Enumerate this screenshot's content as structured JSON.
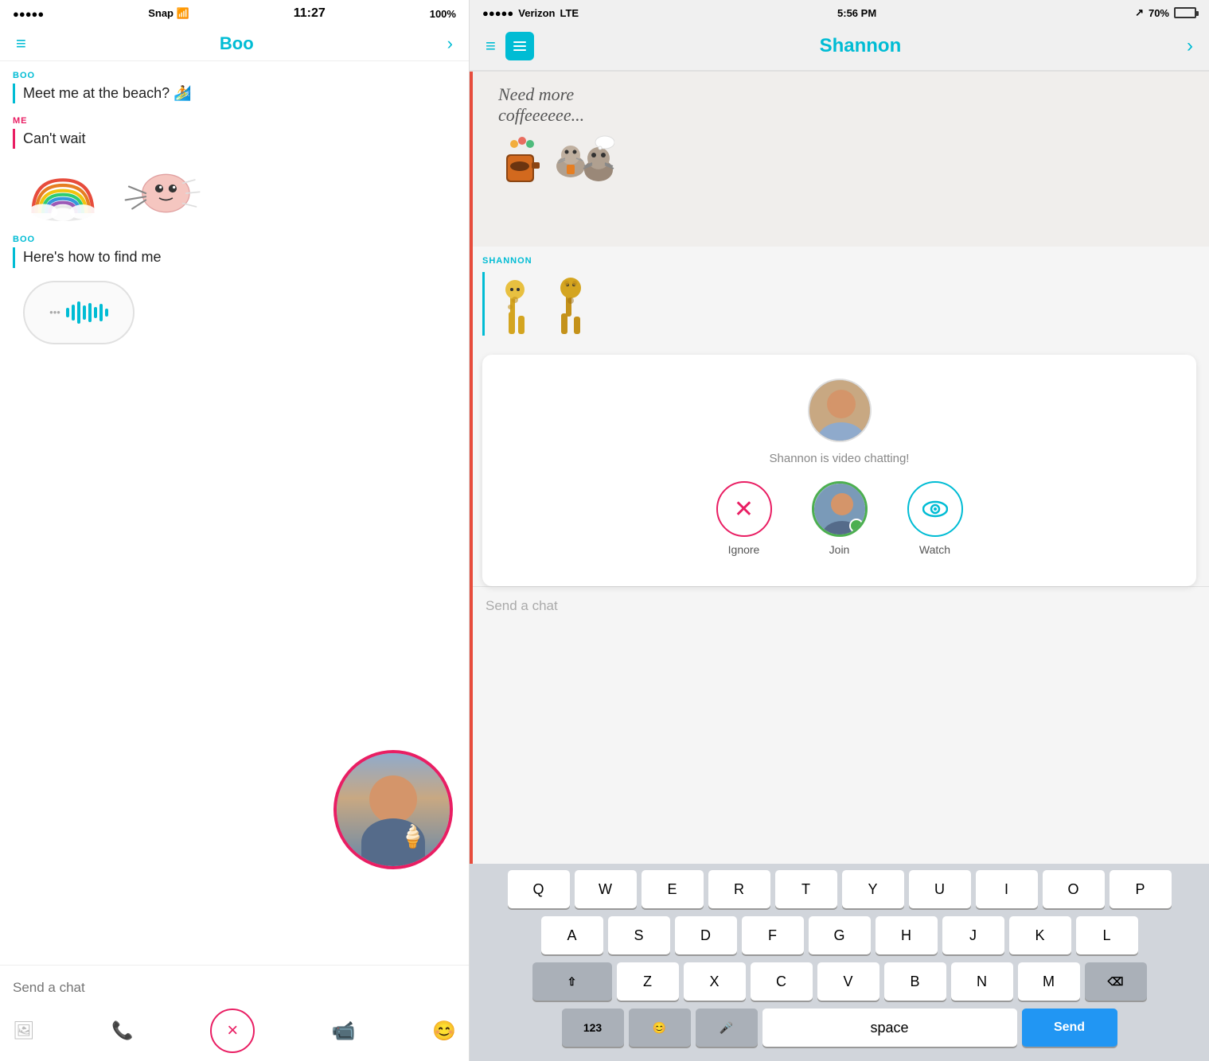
{
  "left": {
    "status_bar": {
      "dots": "●●●●●",
      "carrier": "Snap",
      "wifi": "WiFi",
      "time": "11:27",
      "battery": "100%"
    },
    "header": {
      "hamburger": "≡",
      "title": "Boo",
      "chevron": "›"
    },
    "messages": [
      {
        "sender": "BOO",
        "sender_type": "boo",
        "text": "Meet me at the beach? 🏄"
      },
      {
        "sender": "ME",
        "sender_type": "me",
        "text": "Can't wait"
      },
      {
        "sender": "BOO",
        "sender_type": "boo",
        "text": "Here's how to find me"
      }
    ],
    "bottom_bar": {
      "placeholder": "Send a chat"
    },
    "actions": {
      "cancel": "×",
      "image_icon": "🖼",
      "phone_icon": "📞",
      "video_icon": "📹",
      "emoji_icon": "😊"
    }
  },
  "right": {
    "status_bar": {
      "dots": "●●●●●",
      "carrier": "Verizon",
      "network": "LTE",
      "time": "5:56 PM",
      "location_icon": "↗",
      "battery": "70%"
    },
    "header": {
      "hamburger": "≡",
      "bars_label": "bars-chart",
      "title": "Shannon",
      "chevron": "›"
    },
    "sticker_section": {
      "coffee_text_line1": "Need more",
      "coffee_text_line2": "coffeeeeee..."
    },
    "shannon_label": "SHANNON",
    "video_chat": {
      "status_text": "Shannon is video chatting!",
      "actions": {
        "ignore_label": "Ignore",
        "join_label": "Join",
        "watch_label": "Watch"
      }
    },
    "send_chat": {
      "placeholder": "Send a chat"
    },
    "keyboard": {
      "row1": [
        "Q",
        "W",
        "E",
        "R",
        "T",
        "Y",
        "U",
        "I",
        "O",
        "P"
      ],
      "row2": [
        "A",
        "S",
        "D",
        "F",
        "G",
        "H",
        "J",
        "K",
        "L"
      ],
      "row3": [
        "Z",
        "X",
        "C",
        "V",
        "B",
        "N",
        "M"
      ],
      "special": {
        "shift": "⇧",
        "delete": "⌫",
        "numbers": "123",
        "emoji": "😊",
        "mic": "🎤",
        "space": "space",
        "send": "Send"
      }
    }
  }
}
